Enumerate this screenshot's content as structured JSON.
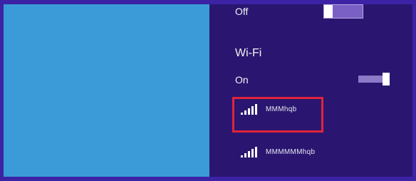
{
  "airplane_mode": {
    "state_label": "Off"
  },
  "wifi": {
    "title": "Wi-Fi",
    "state_label": "On",
    "networks": [
      {
        "name": "MMMhqb",
        "signal": "full",
        "selected": true
      },
      {
        "name": "MMMMMMhqb",
        "signal": "full",
        "selected": false
      }
    ]
  },
  "colors": {
    "panel": "#2a1670",
    "desktop": "#3b9bd8",
    "highlight": "#e0243a"
  }
}
